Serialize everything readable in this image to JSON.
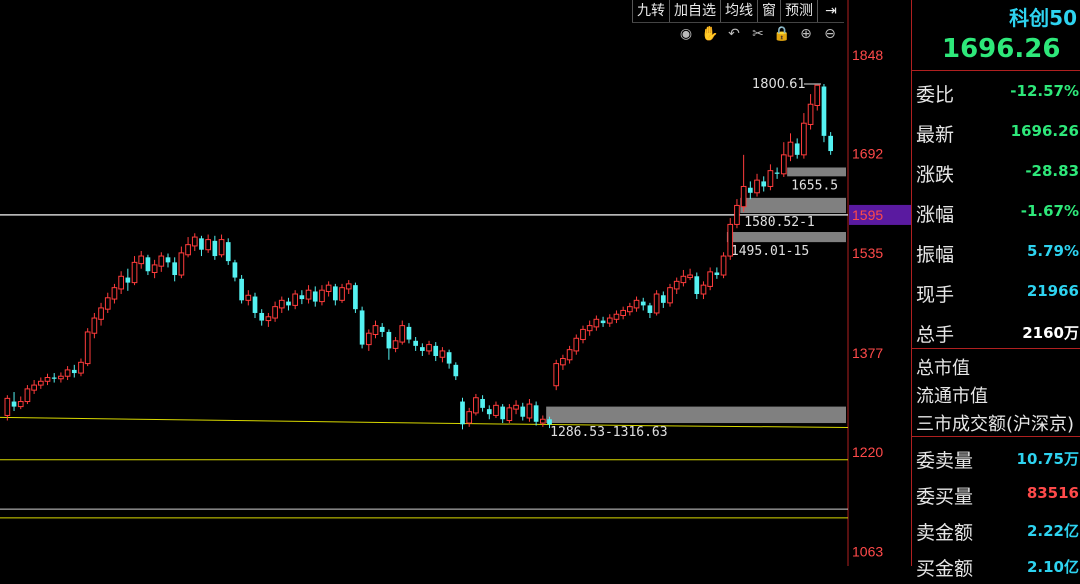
{
  "toolbar": {
    "buttons": [
      "九转",
      "加自选",
      "均线",
      "窗",
      "预测"
    ],
    "arrow_icon": "collapse-right-icon"
  },
  "chart_tools": [
    "eye-icon",
    "hand-icon",
    "undo-icon",
    "scissors-icon",
    "lock-icon",
    "zoom-in-icon",
    "zoom-out-icon"
  ],
  "colors": {
    "up": "#ff3c3c",
    "down": "#54f2f2",
    "axis": "#b02020",
    "price_label": "#ff4a4a",
    "highlight_box": "#5a1aa0",
    "support_zone": "#808080",
    "avg_line": "#d8d800",
    "title": "#2ed3f0",
    "price": "#2ee87a"
  },
  "chart_data": {
    "type": "candlestick",
    "ylim": [
      1040,
      1900
    ],
    "y_ticks": [
      "1848",
      "1692",
      "1595",
      "1535",
      "1377",
      "1220",
      "1063"
    ],
    "y_tick_values": [
      1848,
      1692,
      1595,
      1535,
      1377,
      1220,
      1063
    ],
    "highlight_tick": "1595",
    "current_line": 1595,
    "candles": [
      [
        1278,
        1305,
        1270,
        1310
      ],
      [
        1300,
        1292,
        1285,
        1315
      ],
      [
        1292,
        1300,
        1288,
        1308
      ],
      [
        1300,
        1320,
        1296,
        1326
      ],
      [
        1318,
        1326,
        1312,
        1334
      ],
      [
        1326,
        1332,
        1320,
        1338
      ],
      [
        1332,
        1338,
        1326,
        1344
      ],
      [
        1338,
        1336,
        1330,
        1345
      ],
      [
        1336,
        1340,
        1330,
        1346
      ],
      [
        1340,
        1350,
        1334,
        1356
      ],
      [
        1350,
        1345,
        1338,
        1358
      ],
      [
        1345,
        1362,
        1340,
        1368
      ],
      [
        1360,
        1410,
        1356,
        1416
      ],
      [
        1408,
        1432,
        1400,
        1440
      ],
      [
        1430,
        1448,
        1420,
        1456
      ],
      [
        1446,
        1464,
        1440,
        1472
      ],
      [
        1462,
        1480,
        1455,
        1486
      ],
      [
        1478,
        1498,
        1470,
        1506
      ],
      [
        1496,
        1488,
        1475,
        1510
      ],
      [
        1488,
        1520,
        1484,
        1530
      ],
      [
        1518,
        1530,
        1510,
        1538
      ],
      [
        1528,
        1506,
        1500,
        1532
      ],
      [
        1504,
        1516,
        1495,
        1524
      ],
      [
        1514,
        1530,
        1505,
        1536
      ],
      [
        1528,
        1520,
        1512,
        1534
      ],
      [
        1520,
        1500,
        1490,
        1528
      ],
      [
        1500,
        1535,
        1495,
        1545
      ],
      [
        1532,
        1548,
        1528,
        1560
      ],
      [
        1546,
        1560,
        1538,
        1566
      ],
      [
        1558,
        1540,
        1530,
        1562
      ],
      [
        1540,
        1556,
        1535,
        1564
      ],
      [
        1554,
        1530,
        1524,
        1562
      ],
      [
        1532,
        1556,
        1528,
        1564
      ],
      [
        1552,
        1522,
        1516,
        1558
      ],
      [
        1520,
        1496,
        1490,
        1524
      ],
      [
        1494,
        1460,
        1455,
        1500
      ],
      [
        1460,
        1468,
        1452,
        1476
      ],
      [
        1466,
        1440,
        1432,
        1472
      ],
      [
        1440,
        1428,
        1420,
        1446
      ],
      [
        1428,
        1434,
        1418,
        1440
      ],
      [
        1432,
        1450,
        1426,
        1458
      ],
      [
        1448,
        1460,
        1440,
        1466
      ],
      [
        1458,
        1452,
        1444,
        1464
      ],
      [
        1452,
        1470,
        1446,
        1476
      ],
      [
        1468,
        1462,
        1454,
        1476
      ],
      [
        1462,
        1476,
        1455,
        1484
      ],
      [
        1474,
        1458,
        1450,
        1482
      ],
      [
        1458,
        1476,
        1452,
        1484
      ],
      [
        1474,
        1484,
        1466,
        1490
      ],
      [
        1482,
        1460,
        1452,
        1486
      ],
      [
        1460,
        1480,
        1456,
        1486
      ],
      [
        1478,
        1486,
        1470,
        1492
      ],
      [
        1484,
        1446,
        1440,
        1488
      ],
      [
        1444,
        1390,
        1384,
        1450
      ],
      [
        1390,
        1408,
        1380,
        1414
      ],
      [
        1406,
        1420,
        1400,
        1428
      ],
      [
        1418,
        1410,
        1402,
        1424
      ],
      [
        1410,
        1384,
        1366,
        1414
      ],
      [
        1384,
        1396,
        1378,
        1402
      ],
      [
        1394,
        1420,
        1390,
        1428
      ],
      [
        1418,
        1398,
        1392,
        1424
      ],
      [
        1396,
        1388,
        1380,
        1402
      ],
      [
        1386,
        1380,
        1372,
        1392
      ],
      [
        1380,
        1390,
        1374,
        1396
      ],
      [
        1388,
        1372,
        1364,
        1394
      ],
      [
        1370,
        1380,
        1362,
        1386
      ],
      [
        1378,
        1360,
        1352,
        1382
      ],
      [
        1358,
        1340,
        1334,
        1362
      ],
      [
        1300,
        1264,
        1256,
        1306
      ],
      [
        1266,
        1284,
        1260,
        1290
      ],
      [
        1282,
        1306,
        1278,
        1312
      ],
      [
        1304,
        1290,
        1284,
        1310
      ],
      [
        1288,
        1280,
        1272,
        1294
      ],
      [
        1278,
        1294,
        1274,
        1300
      ],
      [
        1292,
        1272,
        1266,
        1296
      ],
      [
        1270,
        1290,
        1266,
        1296
      ],
      [
        1288,
        1294,
        1280,
        1302
      ],
      [
        1292,
        1276,
        1270,
        1298
      ],
      [
        1274,
        1296,
        1268,
        1304
      ],
      [
        1294,
        1268,
        1262,
        1300
      ],
      [
        1266,
        1272,
        1260,
        1278
      ],
      [
        1272,
        1264,
        1258,
        1276
      ],
      [
        1325,
        1360,
        1318,
        1366
      ],
      [
        1358,
        1368,
        1350,
        1374
      ],
      [
        1366,
        1382,
        1360,
        1388
      ],
      [
        1380,
        1400,
        1374,
        1406
      ],
      [
        1398,
        1414,
        1392,
        1420
      ],
      [
        1412,
        1420,
        1404,
        1428
      ],
      [
        1418,
        1430,
        1412,
        1436
      ],
      [
        1428,
        1424,
        1418,
        1434
      ],
      [
        1424,
        1432,
        1418,
        1438
      ],
      [
        1430,
        1438,
        1424,
        1444
      ],
      [
        1436,
        1444,
        1430,
        1450
      ],
      [
        1442,
        1450,
        1436,
        1456
      ],
      [
        1448,
        1460,
        1442,
        1466
      ],
      [
        1458,
        1452,
        1444,
        1464
      ],
      [
        1452,
        1440,
        1432,
        1456
      ],
      [
        1440,
        1470,
        1436,
        1476
      ],
      [
        1468,
        1456,
        1448,
        1474
      ],
      [
        1456,
        1480,
        1450,
        1486
      ],
      [
        1478,
        1490,
        1470,
        1496
      ],
      [
        1488,
        1498,
        1482,
        1508
      ],
      [
        1496,
        1500,
        1492,
        1510
      ],
      [
        1498,
        1470,
        1462,
        1504
      ],
      [
        1470,
        1484,
        1462,
        1490
      ],
      [
        1482,
        1505,
        1476,
        1512
      ],
      [
        1504,
        1500,
        1494,
        1512
      ],
      [
        1500,
        1530,
        1495,
        1536
      ],
      [
        1530,
        1580,
        1524,
        1590
      ],
      [
        1580,
        1610,
        1574,
        1620
      ],
      [
        1608,
        1640,
        1600,
        1690
      ],
      [
        1638,
        1630,
        1620,
        1648
      ],
      [
        1630,
        1650,
        1624,
        1660
      ],
      [
        1648,
        1640,
        1632,
        1656
      ],
      [
        1640,
        1665,
        1634,
        1675
      ],
      [
        1662,
        1660,
        1652,
        1670
      ],
      [
        1660,
        1690,
        1655,
        1710
      ],
      [
        1688,
        1710,
        1680,
        1724
      ],
      [
        1708,
        1690,
        1684,
        1716
      ],
      [
        1690,
        1740,
        1684,
        1756
      ],
      [
        1738,
        1770,
        1730,
        1786
      ],
      [
        1768,
        1800,
        1760,
        1800
      ],
      [
        1798,
        1720,
        1710,
        1802
      ],
      [
        1720,
        1696,
        1690,
        1726
      ]
    ],
    "avg_line": [
      [
        0,
        1275
      ],
      [
        420,
        1266
      ],
      [
        640,
        1262
      ],
      [
        848,
        1259
      ]
    ],
    "horizontal_lines": [
      {
        "y": 1208,
        "color": "#d8d800"
      },
      {
        "y": 1130,
        "color": "#d0d0d0"
      },
      {
        "y": 1116,
        "color": "#d8d800"
      }
    ],
    "zones": [
      {
        "y1": 1266,
        "y2": 1292,
        "x_start_candle": 81,
        "label": "1286.53-1316.63"
      },
      {
        "y1": 1552,
        "y2": 1568,
        "x_start_candle": 108,
        "label": "1495.01-15"
      },
      {
        "y1": 1598,
        "y2": 1622,
        "x_start_candle": 110,
        "label": "1580.52-1"
      },
      {
        "y1": 1656,
        "y2": 1670,
        "x_start_candle": 117,
        "label": "1655.5"
      }
    ],
    "high_label": "1800.61"
  },
  "panel": {
    "title": "科创50",
    "price": "1696.26",
    "rows": [
      {
        "label": "委比",
        "value": "-12.57%",
        "color": "#2ee87a"
      },
      {
        "label": "最新",
        "value": "1696.26",
        "color": "#2ee87a"
      },
      {
        "label": "涨跌",
        "value": "-28.83",
        "color": "#2ee87a"
      },
      {
        "label": "涨幅",
        "value": "-1.67%",
        "color": "#2ee87a"
      },
      {
        "label": "振幅",
        "value": "5.79%",
        "color": "#2ed3f0"
      },
      {
        "label": "现手",
        "value": "21966",
        "color": "#2ed3f0"
      },
      {
        "label": "总手",
        "value": "2160万",
        "color": "#ffffff"
      }
    ],
    "labels_only": [
      "总市值",
      "流通市值",
      "三市成交额(沪深京)"
    ],
    "rows2": [
      {
        "label": "委卖量",
        "value": "10.75万",
        "color": "#2ed3f0"
      },
      {
        "label": "委买量",
        "value": "83516",
        "color": "#ff4a4a"
      },
      {
        "label": "卖金额",
        "value": "2.22亿",
        "color": "#2ed3f0"
      },
      {
        "label": "买金额",
        "value": "2.10亿",
        "color": "#2ed3f0"
      }
    ]
  }
}
